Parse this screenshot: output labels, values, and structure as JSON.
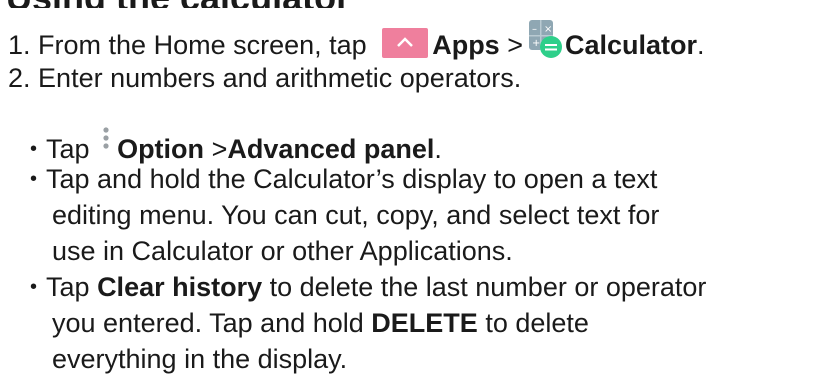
{
  "heading": {
    "text": "Using the calculator"
  },
  "steps": [
    {
      "num": "1.",
      "text_before": "From the Home screen, tap",
      "apps": "Apps",
      "sep": ">",
      "calculator": "Calculator",
      "end": "."
    },
    {
      "num": "2.",
      "text": "Enter numbers and arithmetic operators."
    }
  ],
  "bullets": {
    "marker": "•",
    "b1": {
      "pre": "Tap",
      "option": "Option",
      "sep": ">",
      "panel": "Advanced panel",
      "end": "."
    },
    "b2": {
      "line1": "Tap and hold the Calculator’s display to open a text",
      "line2": "editing menu. You can cut, copy, and select text for",
      "line3": "use in Calculator or other Applications."
    },
    "b3": {
      "pre": "Tap",
      "clear": "Clear history",
      "line1_rest": "to delete the last number or operator",
      "line2_pre": "you entered. Tap and hold",
      "delete": "DELETE",
      "line2_rest": "to delete",
      "line3": "everything in the display."
    }
  },
  "icons": {
    "apps": "apps-chevron-icon",
    "calculator": "calculator-icon",
    "option": "option-menu-icon"
  },
  "colors": {
    "apps_icon_bg": "#ef7f9d",
    "calculator_bg": "#8fa7b3",
    "calculator_accent": "#2ecf8a",
    "text": "#1a1a1a"
  }
}
